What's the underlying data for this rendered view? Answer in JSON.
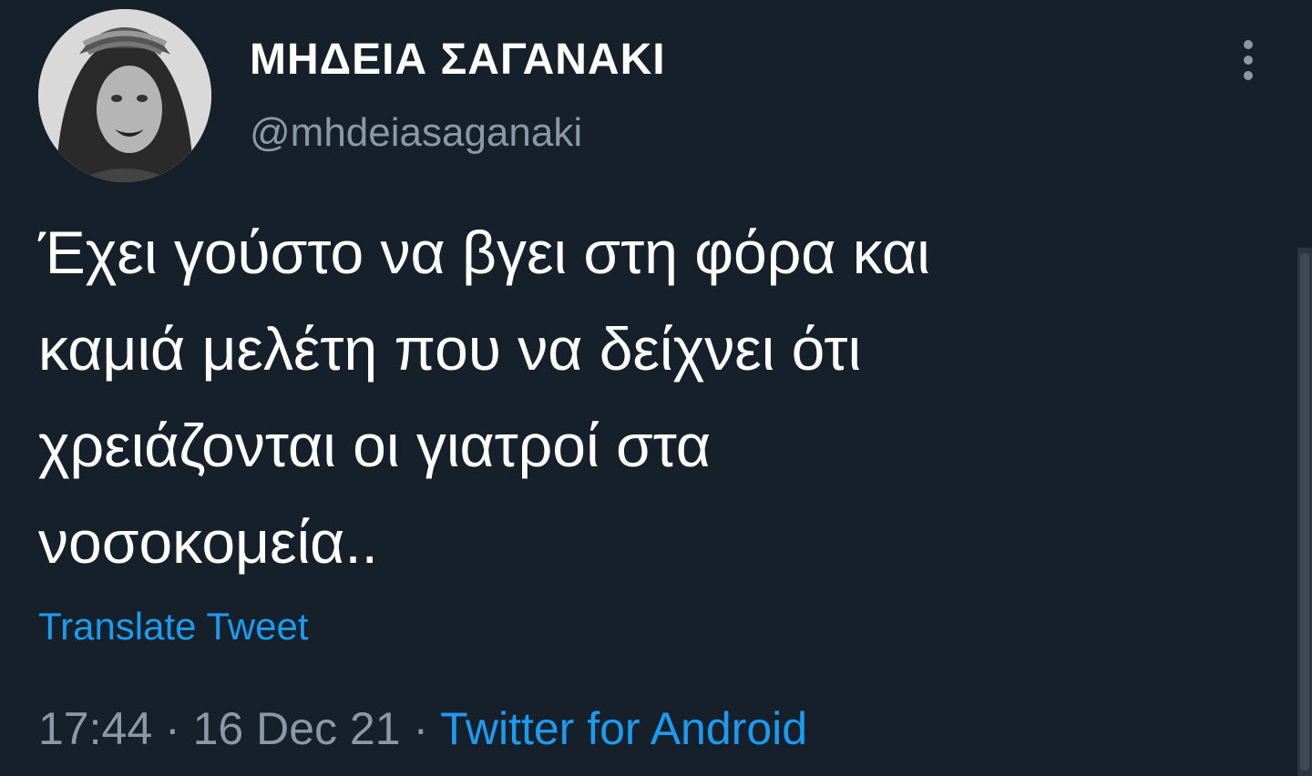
{
  "tweet": {
    "author": {
      "display_name": "ΜΗΔΕΙΑ ΣΑΓΑΝΑΚΙ",
      "handle": "@mhdeiasaganaki",
      "avatar": "avatar-photo"
    },
    "menu_icon": "more-vertical-icon",
    "text_lines": [
      "Έχει γούστο να βγει στη φόρα και",
      "καμιά μελέτη που να δείχνει ότι",
      "χρειάζονται οι γιατροί στα",
      "νοσοκομεία.."
    ],
    "translate_label": "Translate Tweet",
    "meta": {
      "time": "17:44",
      "separator": "·",
      "date": "16 Dec 21",
      "source": "Twitter for Android"
    }
  },
  "colors": {
    "background": "#15202b",
    "text": "#ffffff",
    "secondary": "#8b98a5",
    "accent": "#1d9bf0"
  }
}
